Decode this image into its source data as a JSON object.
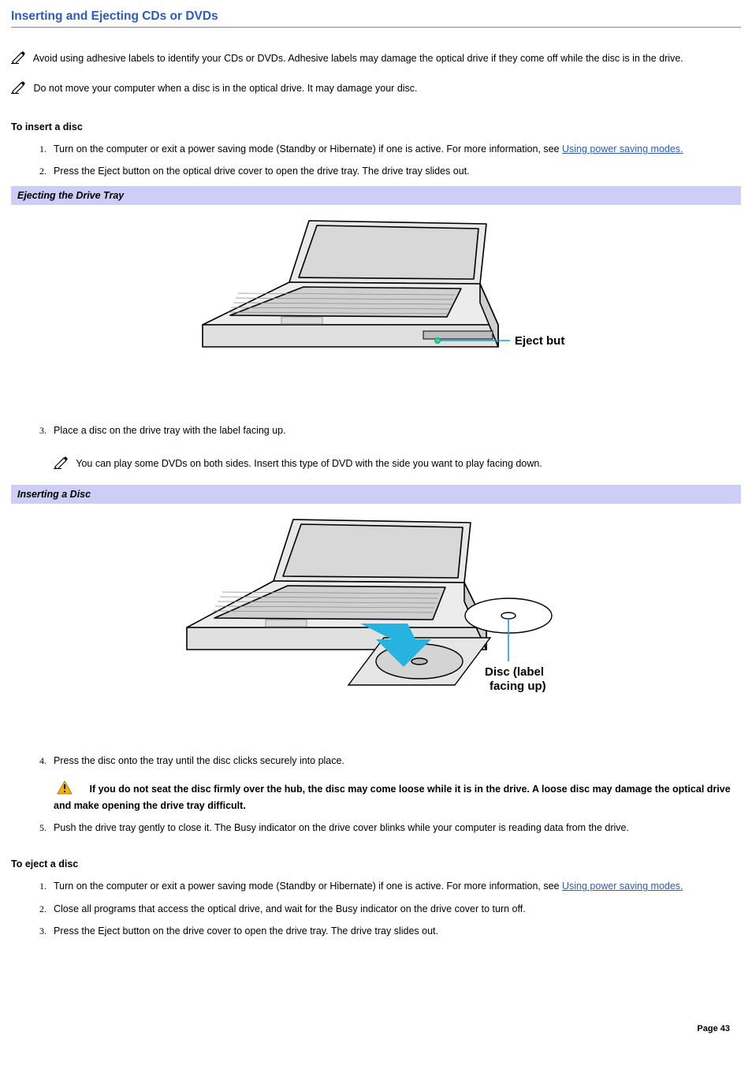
{
  "title": "Inserting and Ejecting CDs or DVDs",
  "note1": "Avoid using adhesive labels to identify your CDs or DVDs. Adhesive labels may damage the optical drive if they come off while the disc is in the drive.",
  "note2": "Do not move your computer when a disc is in the optical drive. It may damage your disc.",
  "insert_heading": "To insert a disc",
  "insert_steps": {
    "s1a": "Turn on the computer or exit a power saving mode (Standby or Hibernate) if one is active. For more information, see ",
    "s1_link": "Using power saving modes.",
    "s2": "Press the Eject button on the optical drive cover to open the drive tray. The drive tray slides out.",
    "s3": "Place a disc on the drive tray with the label facing up.",
    "s3_note": "You can play some DVDs on both sides. Insert this type of DVD with the side you want to play facing down.",
    "s4": "Press the disc onto the tray until the disc clicks securely into place.",
    "s4_warn": "If you do not seat the disc firmly over the hub, the disc may come loose while it is in the drive. A loose disc may damage the optical drive and make opening the drive tray difficult.",
    "s5": "Push the drive tray gently to close it. The Busy indicator on the drive cover blinks while your computer is reading data from the drive."
  },
  "panel1": "Ejecting the Drive Tray",
  "fig1_label": "Eject button",
  "panel2": "Inserting a Disc",
  "fig2_label1": "Disc (label",
  "fig2_label2": "facing up)",
  "eject_heading": "To eject a disc",
  "eject_steps": {
    "s1a": "Turn on the computer or exit a power saving mode (Standby or Hibernate) if one is active. For more information, see ",
    "s1_link": "Using power saving modes.",
    "s2": "Close all programs that access the optical drive, and wait for the Busy indicator on the drive cover to turn off.",
    "s3": "Press the Eject button on the drive cover to open the drive tray. The drive tray slides out."
  },
  "page_label": "Page 43"
}
